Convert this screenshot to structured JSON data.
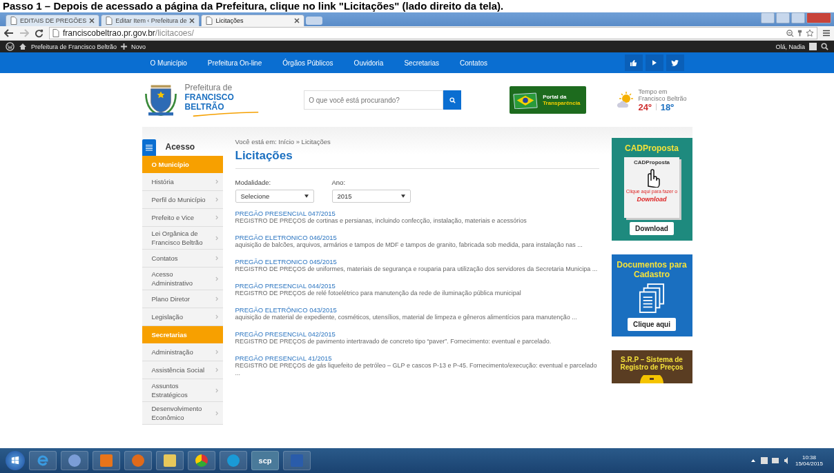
{
  "caption": "Passo 1 – Depois de acessado a página da Prefeitura, clique no link \"Licitações\" (lado direito da tela).",
  "browser": {
    "tabs": [
      {
        "label": "EDITAIS DE PREGÕES",
        "selected": false
      },
      {
        "label": "Editar Item ‹ Prefeitura de",
        "selected": false
      },
      {
        "label": "Licitações",
        "selected": true
      }
    ],
    "url_host": "franciscobeltrao.pr.gov.br",
    "url_path": "/licitacoes/"
  },
  "admin_bar": {
    "site": "Prefeitura de Francisco Beltrão",
    "new": "Novo",
    "greeting": "Olá, Nadia"
  },
  "nav": [
    "O Município",
    "Prefeitura On-line",
    "Órgãos Públicos",
    "Ouvidoria",
    "Secretarias",
    "Contatos"
  ],
  "header": {
    "logo_top": "Prefeitura de",
    "logo_bottom": "FRANCISCO BELTRÃO",
    "search_placeholder": "O que você está procurando?",
    "portal_top": "Portal da",
    "portal_bottom": "Transparência",
    "weather_label": "Tempo em Francisco Beltrão",
    "temp_max": "24º",
    "temp_min": "18º"
  },
  "sidebar": {
    "title": "Acesso",
    "items": [
      {
        "kind": "section",
        "label": "O Município"
      },
      {
        "kind": "link",
        "label": "História"
      },
      {
        "kind": "link",
        "label": "Perfil do Município"
      },
      {
        "kind": "link",
        "label": "Prefeito e Vice"
      },
      {
        "kind": "link",
        "label": "Lei Orgânica de Francisco Beltrão"
      },
      {
        "kind": "link",
        "label": "Contatos"
      },
      {
        "kind": "link",
        "label": "Acesso Administrativo"
      },
      {
        "kind": "link",
        "label": "Plano Diretor"
      },
      {
        "kind": "link",
        "label": "Legislação"
      },
      {
        "kind": "section",
        "label": "Secretarias"
      },
      {
        "kind": "link",
        "label": "Administração"
      },
      {
        "kind": "link",
        "label": "Assistência Social"
      },
      {
        "kind": "link",
        "label": "Assuntos Estratégicos"
      },
      {
        "kind": "link",
        "label": "Desenvolvimento Econômico"
      }
    ]
  },
  "content": {
    "breadcrumb": "Você está em: Início » Licitações",
    "title": "Licitações",
    "filters": [
      {
        "label": "Modalidade:",
        "value": "Selecione"
      },
      {
        "label": "Ano:",
        "value": "2015"
      }
    ],
    "listings": [
      {
        "title": "PREGÃO PRESENCIAL 047/2015",
        "description": "REGISTRO DE PREÇOS de cortinas e persianas, incluindo confecção, instalação, materiais e acessórios"
      },
      {
        "title": "PREGÃO ELETRONICO 046/2015",
        "description": "aquisição de balcões, arquivos, armários e tampos de MDF e tampos de granito, fabricada sob medida, para instalação nas ..."
      },
      {
        "title": "PREGÃO ELETRONICO 045/2015",
        "description": "REGISTRO DE PREÇOS de uniformes, materiais de segurança e rouparia para utilização dos servidores da Secretaria Municipa ..."
      },
      {
        "title": "PREGÃO PRESENCIAL 044/2015",
        "description": "REGISTRO DE PREÇOS de relé fotoelétrico para manutenção da rede de iluminação pública municipal"
      },
      {
        "title": "PREGÃO ELETRÔNICO 043/2015",
        "description": "aquisição de material de expediente, cosméticos, utensílios, material de limpeza e gêneros alimentícios para manutenção ..."
      },
      {
        "title": "PREGÃO PRESENCIAL 042/2015",
        "description": "REGISTRO DE PREÇOS de pavimento intertravado de concreto tipo “paver”. Fornecimento: eventual e parcelado."
      },
      {
        "title": "PREGÃO PRESENCIAL 41/2015",
        "description": "REGISTRO DE PREÇOS de gás liquefeito de petróleo – GLP e cascos P-13 e P-45. Fornecimento/execução: eventual e parcelado ..."
      }
    ]
  },
  "promos": [
    {
      "kind": "software",
      "title": "CADProposta",
      "box_title": "CADProposta",
      "box_note": "Clique aqui para fazer o",
      "box_action": "Download",
      "button": "Download"
    },
    {
      "kind": "documents",
      "title": "Documentos para Cadastro",
      "button": "Clique aqui"
    },
    {
      "kind": "coin",
      "title": "S.R.P – Sistema de Registro de Preços"
    }
  ],
  "taskbar": {
    "app_label": "scp",
    "time": "10:38",
    "date": "15/04/2015"
  }
}
